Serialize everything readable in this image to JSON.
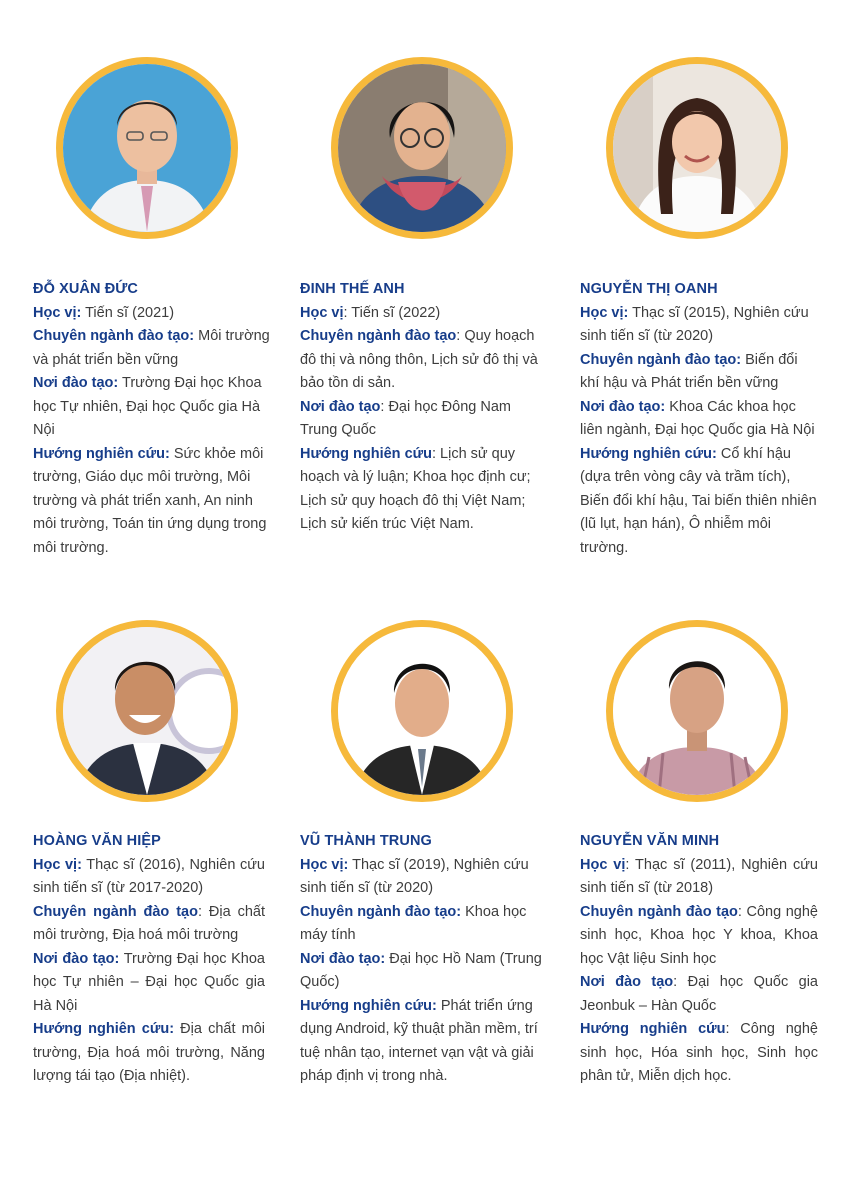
{
  "colors": {
    "ring": "#f6b93b",
    "heading": "#173d8a",
    "text": "#3d3d3d"
  },
  "profiles": [
    {
      "name": "ĐỖ XUÂN ĐỨC",
      "portrait_icon": "person-photo",
      "rows": [
        {
          "label": "Học vị:",
          "value": " Tiến sĩ (2021)"
        },
        {
          "label": "Chuyên ngành đào tạo:",
          "value": " Môi trường và phát triển bền vững"
        },
        {
          "label": "Nơi đào tạo:",
          "value": " Trường Đại học Khoa học Tự nhiên, Đại học Quốc gia  Hà Nội"
        },
        {
          "label": "Hướng nghiên cứu:",
          "value": " Sức khỏe môi trường, Giáo dục môi trường, Môi trường và phát triển xanh, An ninh môi trường, Toán tin ứng dụng trong môi trường."
        }
      ]
    },
    {
      "name": "ĐINH THẾ ANH",
      "portrait_icon": "person-photo",
      "rows": [
        {
          "label": "Học vị",
          "value": ": Tiến sĩ (2022)"
        },
        {
          "label": "Chuyên ngành đào tạo",
          "value": ": Quy hoạch đô thị và nông thôn, Lịch sử đô thị và bảo tồn di sản."
        },
        {
          "label": "Nơi đào tạo",
          "value": ": Đại học Đông Nam Trung Quốc"
        },
        {
          "label": "Hướng nghiên cứu",
          "value": ": Lịch sử quy hoạch và lý luận; Khoa học định cư; Lịch sử quy hoạch đô thị Việt Nam; Lịch sử kiến trúc Việt Nam."
        }
      ]
    },
    {
      "name": "NGUYỄN THỊ OANH",
      "portrait_icon": "person-photo",
      "rows": [
        {
          "label": "Học vị:",
          "value": " Thạc sĩ (2015), Nghiên cứu sinh tiến sĩ (từ 2020)"
        },
        {
          "label": "Chuyên ngành đào tạo:",
          "value": " Biến đổi khí hậu và Phát triển bền vững"
        },
        {
          "label": "Nơi đào tạo:",
          "value": " Khoa Các khoa học liên ngành, Đại học Quốc gia Hà Nội"
        },
        {
          "label": "Hướng nghiên cứu:",
          "value": " Cổ khí hậu (dựa trên vòng cây và trầm tích), Biến đổi khí hậu, Tai biến thiên nhiên (lũ lụt, hạn hán), Ô nhiễm môi trường."
        }
      ]
    },
    {
      "name": "HOÀNG VĂN HIỆP",
      "portrait_icon": "person-photo",
      "rows": [
        {
          "label": "Học vị:",
          "value": " Thạc sĩ (2016), Nghiên cứu sinh tiến sĩ (từ 2017-2020)"
        },
        {
          "label": "Chuyên ngành đào tạo",
          "value": ": Địa chất môi trường, Địa hoá môi trường"
        },
        {
          "label": "Nơi đào tạo:",
          "value": " Trường Đại học Khoa học Tự nhiên – Đại học Quốc gia Hà Nội"
        },
        {
          "label": "Hướng nghiên cứu:",
          "value": " Địa chất môi trường, Địa hoá môi trường, Năng lượng tái tạo (Địa nhiệt)."
        }
      ]
    },
    {
      "name": "VŨ THÀNH TRUNG",
      "portrait_icon": "person-photo",
      "rows": [
        {
          "label": "Học vị:",
          "value": " Thạc sĩ (2019), Nghiên cứu sinh tiến sĩ (từ 2020)"
        },
        {
          "label": "Chuyên ngành đào tạo:",
          "value": " Khoa học máy tính"
        },
        {
          "label": "Nơi đào tạo:",
          "value": " Đại học Hồ Nam (Trung Quốc)"
        },
        {
          "label": "Hướng nghiên cứu:",
          "value": " Phát triển ứng dụng Android, kỹ thuật phần mềm, trí tuệ nhân tạo, internet vạn vật và giải pháp định vị trong nhà."
        }
      ]
    },
    {
      "name": "NGUYỄN VĂN MINH",
      "portrait_icon": "person-photo",
      "rows": [
        {
          "label": "Học vị",
          "value": ": Thạc sĩ (2011), Nghiên cứu sinh tiến sĩ (từ 2018)"
        },
        {
          "label": "Chuyên ngành đào tạo",
          "value": ": Công nghệ sinh học, Khoa học Y khoa, Khoa học Vật liệu Sinh học"
        },
        {
          "label": "Nơi đào tạo",
          "value": ": Đại học Quốc gia Jeonbuk – Hàn Quốc"
        },
        {
          "label": "Hướng nghiên cứu",
          "value": ": Công nghệ sinh học, Hóa sinh học, Sinh học phân tử, Miễn dịch học."
        }
      ]
    }
  ]
}
